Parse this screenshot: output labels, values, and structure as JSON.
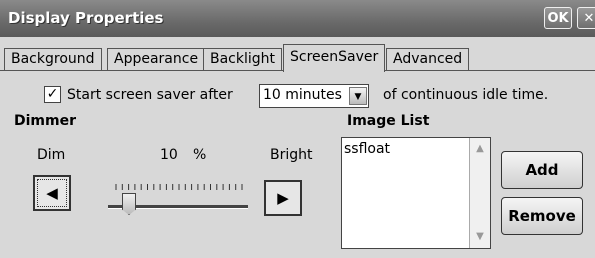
{
  "window": {
    "title": "Display Properties",
    "ok_label": "OK",
    "close_label": "✕"
  },
  "tabs": [
    "Background",
    "Appearance",
    "Backlight",
    "ScreenSaver",
    "Advanced"
  ],
  "active_tab": "ScreenSaver",
  "screensaver": {
    "checkbox_checked": true,
    "checkbox_label": "Start screen saver after",
    "idle_value": "10 minutes",
    "idle_suffix": "of continuous idle time."
  },
  "dimmer": {
    "heading": "Dimmer",
    "dim_label": "Dim",
    "bright_label": "Bright",
    "value": "10",
    "unit": "%",
    "level_percent": 10,
    "left_arrow": "◀",
    "right_arrow": "▶"
  },
  "image_list": {
    "heading": "Image List",
    "items": [
      "ssfloat"
    ],
    "add_label": "Add",
    "remove_label": "Remove"
  },
  "icons": {
    "check": "✓",
    "dropdown": "▼",
    "scroll_up": "▲",
    "scroll_down": "▼"
  },
  "colors": {
    "titlebar": "#6a6a6a",
    "window_bg": "#d8d8d8"
  }
}
